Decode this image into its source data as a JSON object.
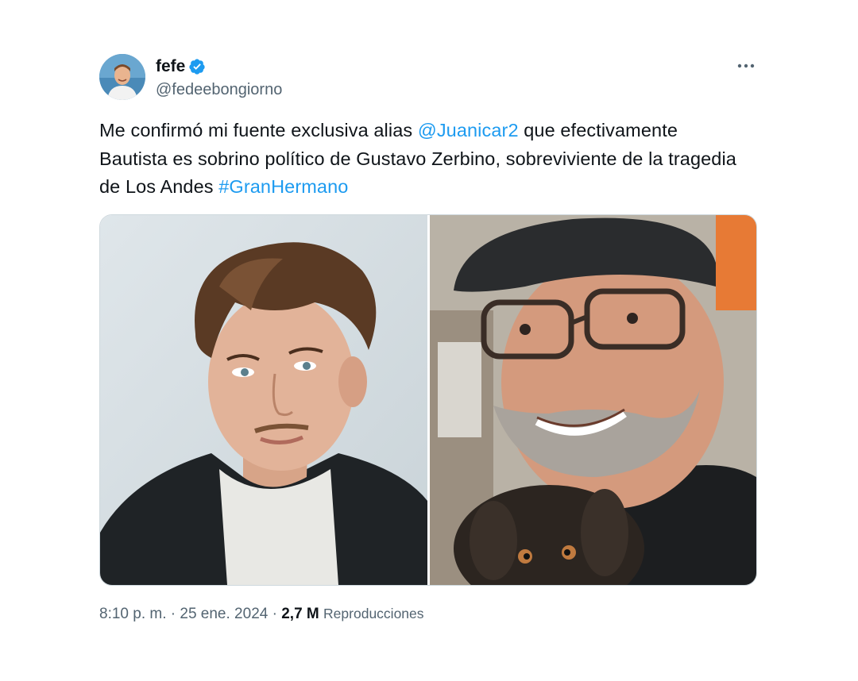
{
  "tweet": {
    "author": {
      "display_name": "fefe",
      "handle": "@fedeebongiorno",
      "verified": true,
      "avatar_icon": "user-avatar-photo"
    },
    "more_icon": "more-options-icon",
    "text": {
      "part1": "Me confirmó mi fuente exclusiva alias ",
      "mention": "@Juanicar2",
      "part2": " que efectivamente Bautista es sobrino político de Gustavo Zerbino, sobreviviente de la tragedia de Los Andes ",
      "hashtag": "#GranHermano"
    },
    "media": [
      {
        "icon": "photo-young-man"
      },
      {
        "icon": "photo-older-man-with-puppy"
      }
    ],
    "meta": {
      "time": "8:10 p. m.",
      "separator": " · ",
      "date": "25 ene. 2024",
      "views_count": "2,7 M",
      "views_label": "Reproducciones"
    },
    "colors": {
      "link": "#1d9bf0",
      "verified_badge": "#1d9bf0",
      "secondary_text": "#536471",
      "primary_text": "#0f1419"
    }
  }
}
